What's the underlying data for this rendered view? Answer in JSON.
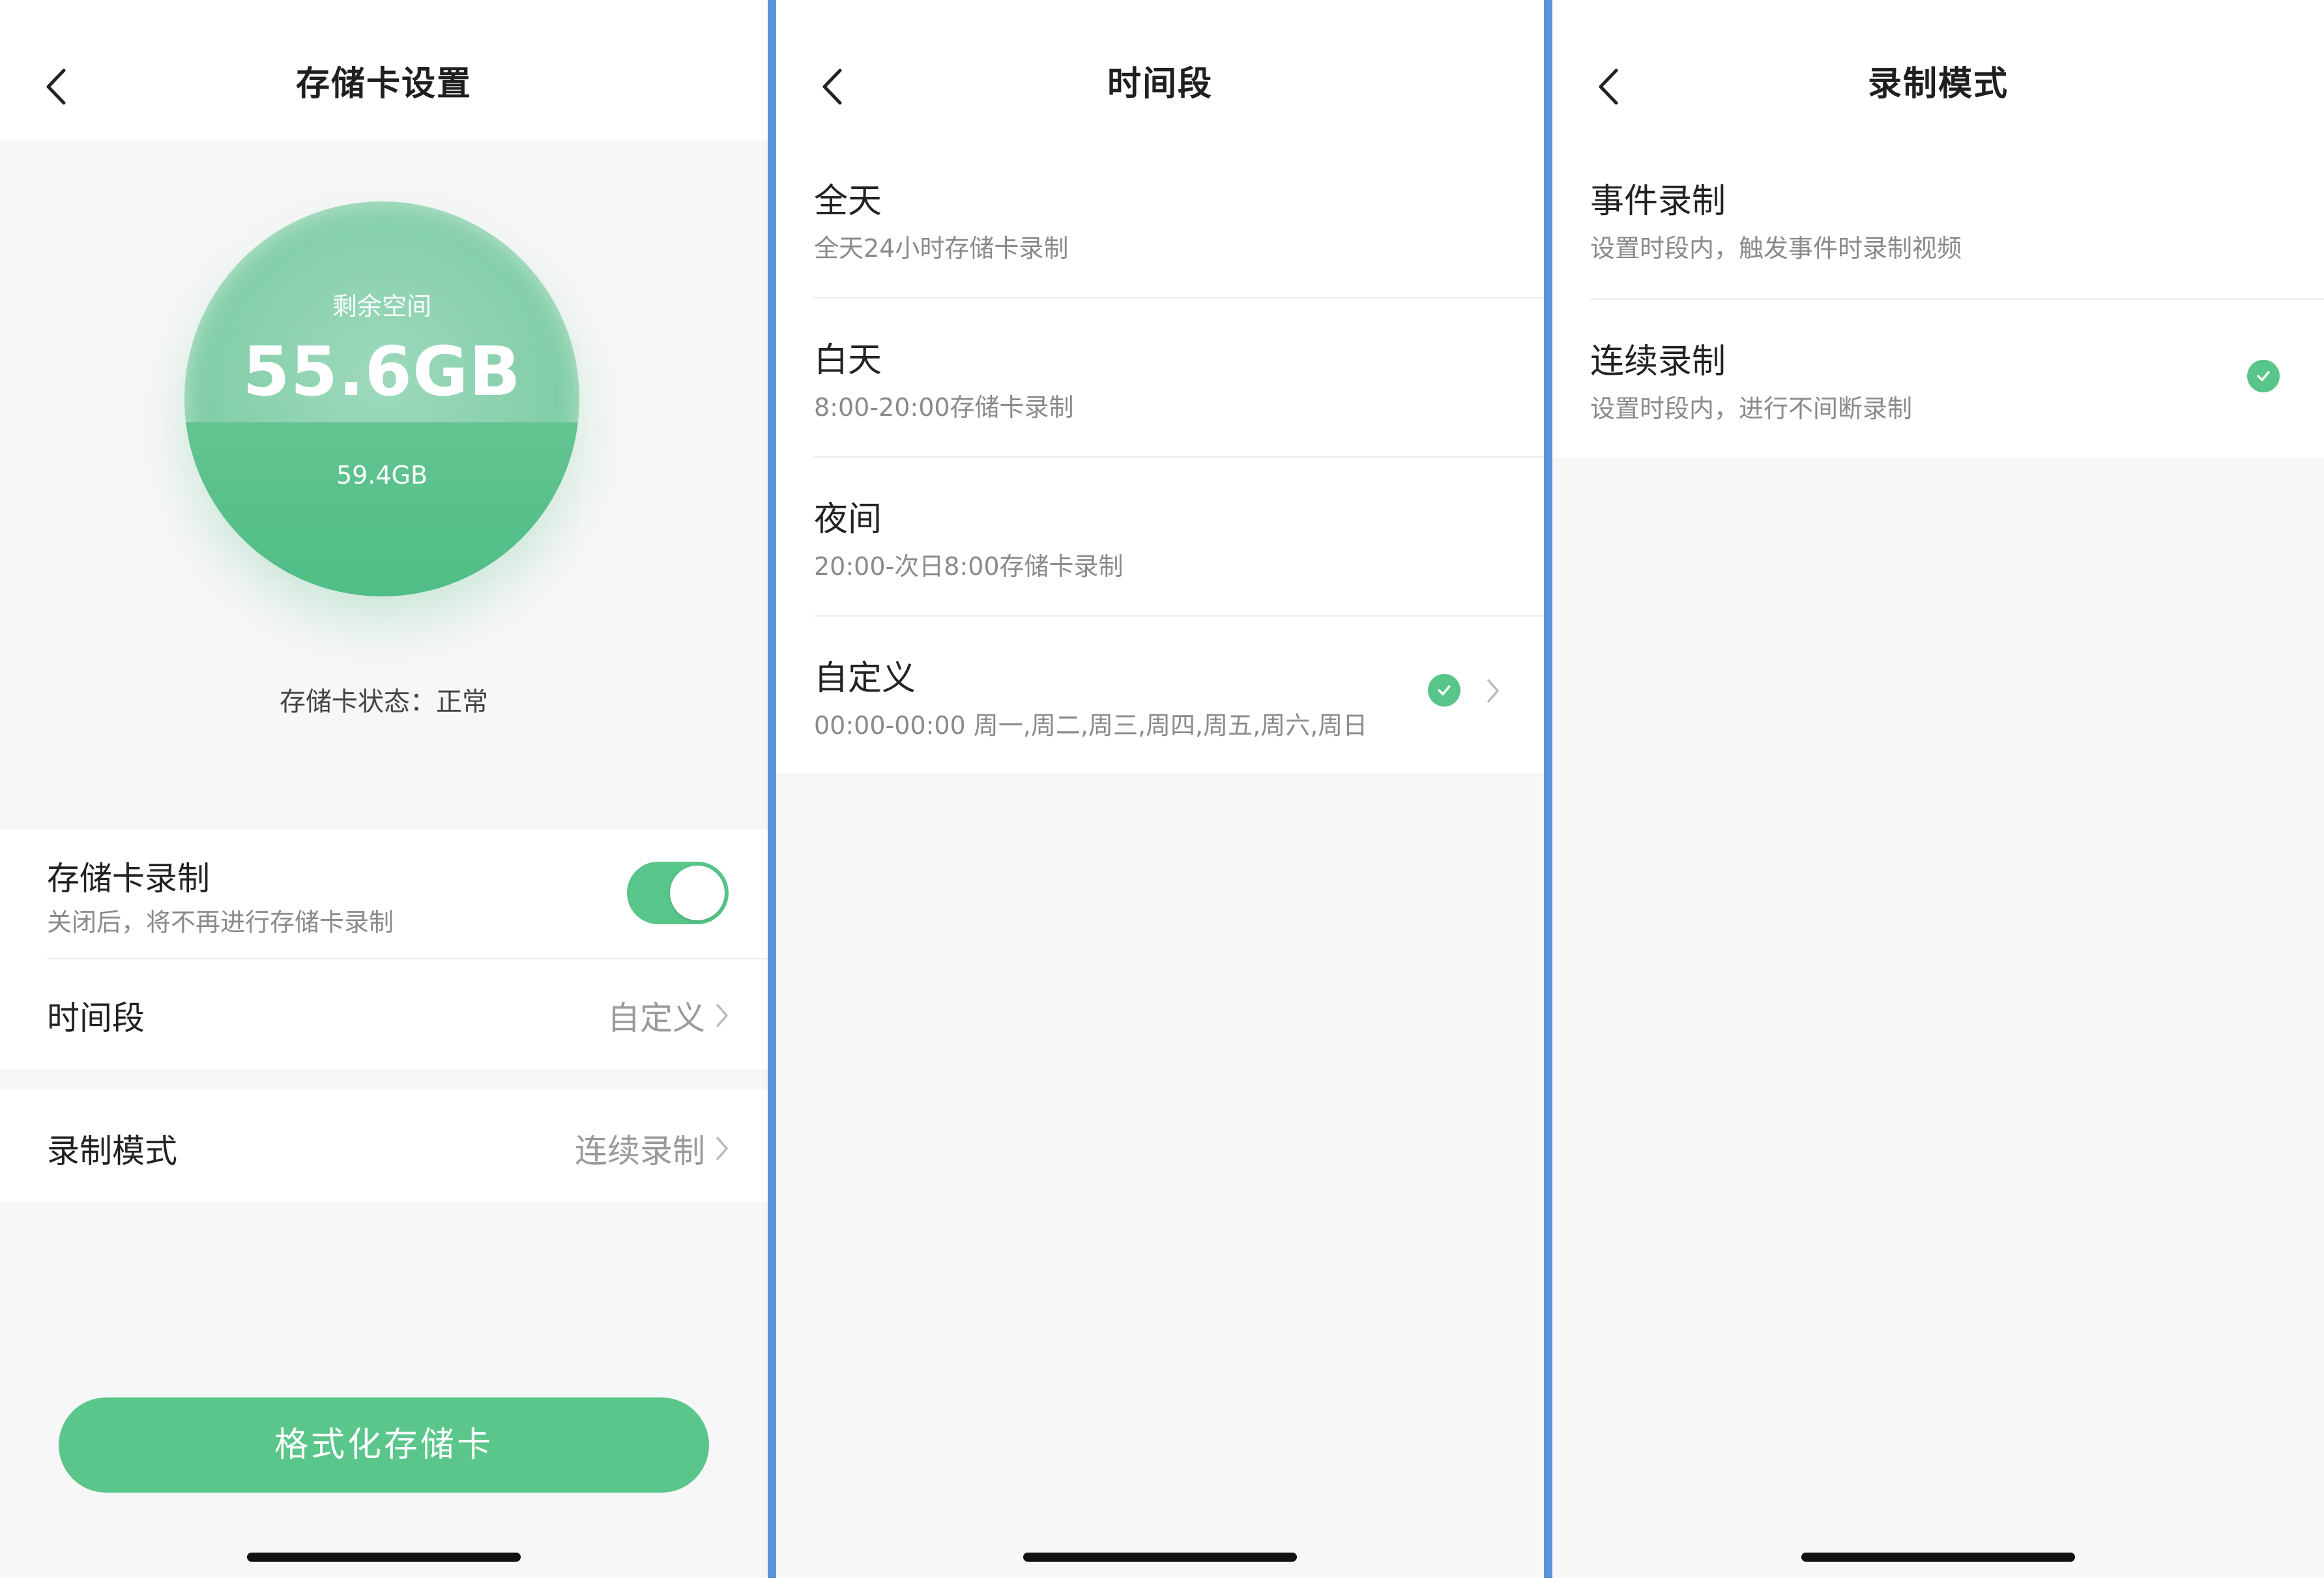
{
  "colors": {
    "accent": "#58c58a",
    "divider": "#5b93d9"
  },
  "screen1": {
    "title": "存储卡设置",
    "remaining_label": "剩余空间",
    "remaining_value": "55.6GB",
    "total_value": "59.4GB",
    "used_fraction": 0.44,
    "status_text": "存储卡状态：正常",
    "recording": {
      "title": "存储卡录制",
      "subtitle": "关闭后，将不再进行存储卡录制",
      "enabled": true
    },
    "time_period": {
      "label": "时间段",
      "value": "自定义"
    },
    "record_mode": {
      "label": "录制模式",
      "value": "连续录制"
    },
    "format_button": "格式化存储卡"
  },
  "screen2": {
    "title": "时间段",
    "options": [
      {
        "title": "全天",
        "subtitle": "全天24小时存储卡录制",
        "selected": false
      },
      {
        "title": "白天",
        "subtitle": "8:00-20:00存储卡录制",
        "selected": false
      },
      {
        "title": "夜间",
        "subtitle": "20:00-次日8:00存储卡录制",
        "selected": false
      },
      {
        "title": "自定义",
        "subtitle": "00:00-00:00 周一,周二,周三,周四,周五,周六,周日",
        "selected": true
      }
    ]
  },
  "screen3": {
    "title": "录制模式",
    "options": [
      {
        "title": "事件录制",
        "subtitle": "设置时段内，触发事件时录制视频",
        "selected": false
      },
      {
        "title": "连续录制",
        "subtitle": "设置时段内，进行不间断录制",
        "selected": true
      }
    ]
  },
  "icons": {
    "back": "chevron-left-icon",
    "chevron": "chevron-right-icon",
    "check": "check-circle-icon"
  }
}
